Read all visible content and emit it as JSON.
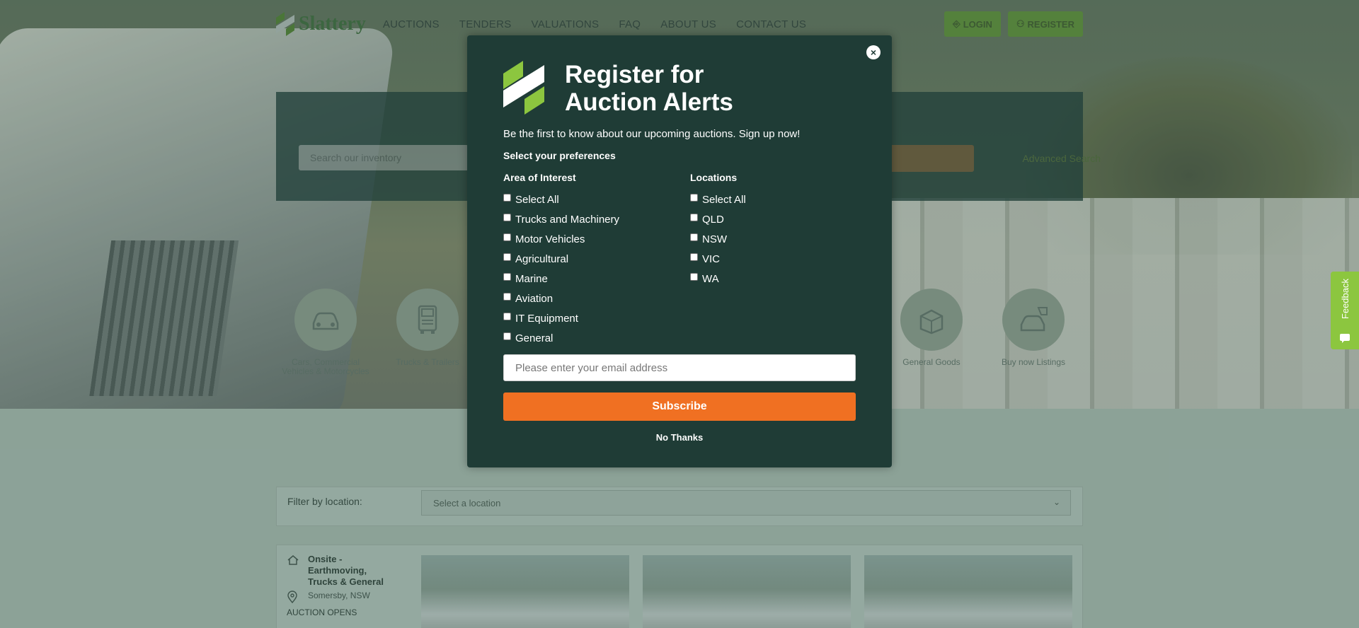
{
  "header": {
    "brand": "Slattery",
    "nav": [
      "AUCTIONS",
      "TENDERS",
      "VALUATIONS",
      "FAQ",
      "ABOUT US",
      "CONTACT US"
    ],
    "login_label": "LOGIN",
    "register_label": "REGISTER"
  },
  "search": {
    "placeholder": "Search our inventory",
    "advanced_label": "Advanced Search"
  },
  "categories": [
    {
      "label": "Cars, Commercial Vehicles & Motorcycles",
      "icon": "car-icon"
    },
    {
      "label": "Trucks & Trailers",
      "icon": "truck-icon"
    },
    {
      "label": "General Goods",
      "icon": "box-icon"
    },
    {
      "label": "Buy now Listings",
      "icon": "tag-car-icon"
    }
  ],
  "filter": {
    "label": "Filter by location:",
    "placeholder": "Select a location"
  },
  "listing": {
    "title": "Onsite - Earthmoving, Trucks & General",
    "location": "Somersby, NSW",
    "status": "AUCTION OPENS"
  },
  "feedback_label": "Feedback",
  "modal": {
    "close": "×",
    "title_line1": "Register for",
    "title_line2": "Auction Alerts",
    "subtitle": "Be the first to know about our upcoming auctions. Sign up now!",
    "preferences_label": "Select your preferences",
    "interest_heading": "Area of Interest",
    "interest_options": [
      "Select All",
      "Trucks and Machinery",
      "Motor Vehicles",
      "Agricultural",
      "Marine",
      "Aviation",
      "IT Equipment",
      "General"
    ],
    "locations_heading": "Locations",
    "location_options": [
      "Select All",
      "QLD",
      "NSW",
      "VIC",
      "WA"
    ],
    "email_placeholder": "Please enter your email address",
    "subscribe_label": "Subscribe",
    "no_thanks_label": "No Thanks"
  },
  "colors": {
    "modal_bg": "#1f3c36",
    "accent_orange": "#f07022",
    "brand_green": "#8cc63f"
  }
}
